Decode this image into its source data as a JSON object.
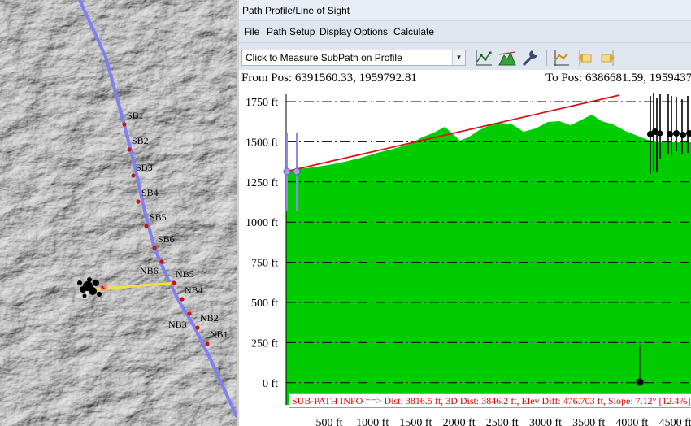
{
  "map": {
    "waypoints": [
      {
        "label": "SB1"
      },
      {
        "label": "SB2"
      },
      {
        "label": "SB3"
      },
      {
        "label": "SB4"
      },
      {
        "label": "SB5"
      },
      {
        "label": "SB6"
      },
      {
        "label": "NB6"
      },
      {
        "label": "NB5"
      },
      {
        "label": "NB4"
      },
      {
        "label": "NB3"
      },
      {
        "label": "NB2"
      },
      {
        "label": "NB1"
      }
    ],
    "colors": {
      "path_line": "#8080f0",
      "sight_line": "#f0e040",
      "waypoint": "#cc1111",
      "terrain": "#b9b9b9"
    }
  },
  "window": {
    "title": "Path Profile/Line of Sight",
    "menu": [
      "File",
      "Path Setup",
      "Display Options",
      "Calculate"
    ],
    "mode_select": {
      "value": "Click to Measure SubPath on Profile"
    },
    "toolbar_icons": [
      "profile-points-icon",
      "terrain-profile-icon",
      "wrench-icon",
      "profile-line-icon",
      "path-reverse-left-icon",
      "path-reverse-right-icon"
    ]
  },
  "profile": {
    "from_pos": "From Pos: 6391560.33, 1959792.81",
    "to_pos": "To Pos: 6386681.59, 1959437",
    "y_ticks": [
      "1750 ft",
      "1500 ft",
      "1250 ft",
      "1000 ft",
      "750 ft",
      "500 ft",
      "250 ft",
      "0 ft"
    ],
    "x_ticks": [
      "500 ft",
      "1000 ft",
      "1500 ft",
      "2000 ft",
      "2500 ft",
      "3000 ft",
      "3500 ft",
      "4000 ft",
      "4500 ft"
    ],
    "subpath_info": "SUB-PATH INFO ==> Dist: 3816.5 ft, 3D Dist: 3846.2 ft, Elev Diff: 476.703 ft, Slope: 7.12° [12.4%]",
    "colors": {
      "terrain_fill": "#00cc00",
      "sight_line": "#dd1111",
      "grid": "#000000",
      "marker": "#9090e0"
    }
  }
}
